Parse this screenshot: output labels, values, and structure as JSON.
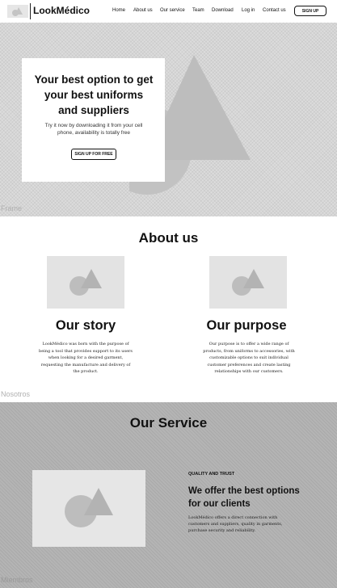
{
  "nav": {
    "brand": "LookMédico",
    "links": [
      "Home",
      "About us",
      "Our service",
      "Team",
      "Download",
      "Log in",
      "Contact us"
    ],
    "signup_label": "SIGN UP"
  },
  "hero": {
    "title": "Your best option to get your best uniforms and suppliers",
    "subtitle": "Try it now by downloading it from your cell phone, availability is totally free",
    "button_label": "SIGN UP FOR FREE",
    "frame_label": "Frame"
  },
  "about": {
    "title": "About us",
    "story": {
      "title": "Our story",
      "text": "LookMédico was born with the purpose of being a tool that provides support to its users when looking for a desired garment, requesting the manufacture and delivery of the product."
    },
    "purpose": {
      "title": "Our purpose",
      "text": "Our purpose is to offer a wide range of products, from uniforms to accessories, with customizable options to suit individual customer preferences and create lasting relationships with our customers."
    },
    "section_label": "Nosotros"
  },
  "service": {
    "title": "Our Service",
    "kicker": "QUALITY AND TRUST",
    "heading": "We offer the best options for our clients",
    "text": "LookMédico offers a direct connection with customers and suppliers, quality in garments, purchase security and reliability.",
    "section_label": "Miembros"
  }
}
